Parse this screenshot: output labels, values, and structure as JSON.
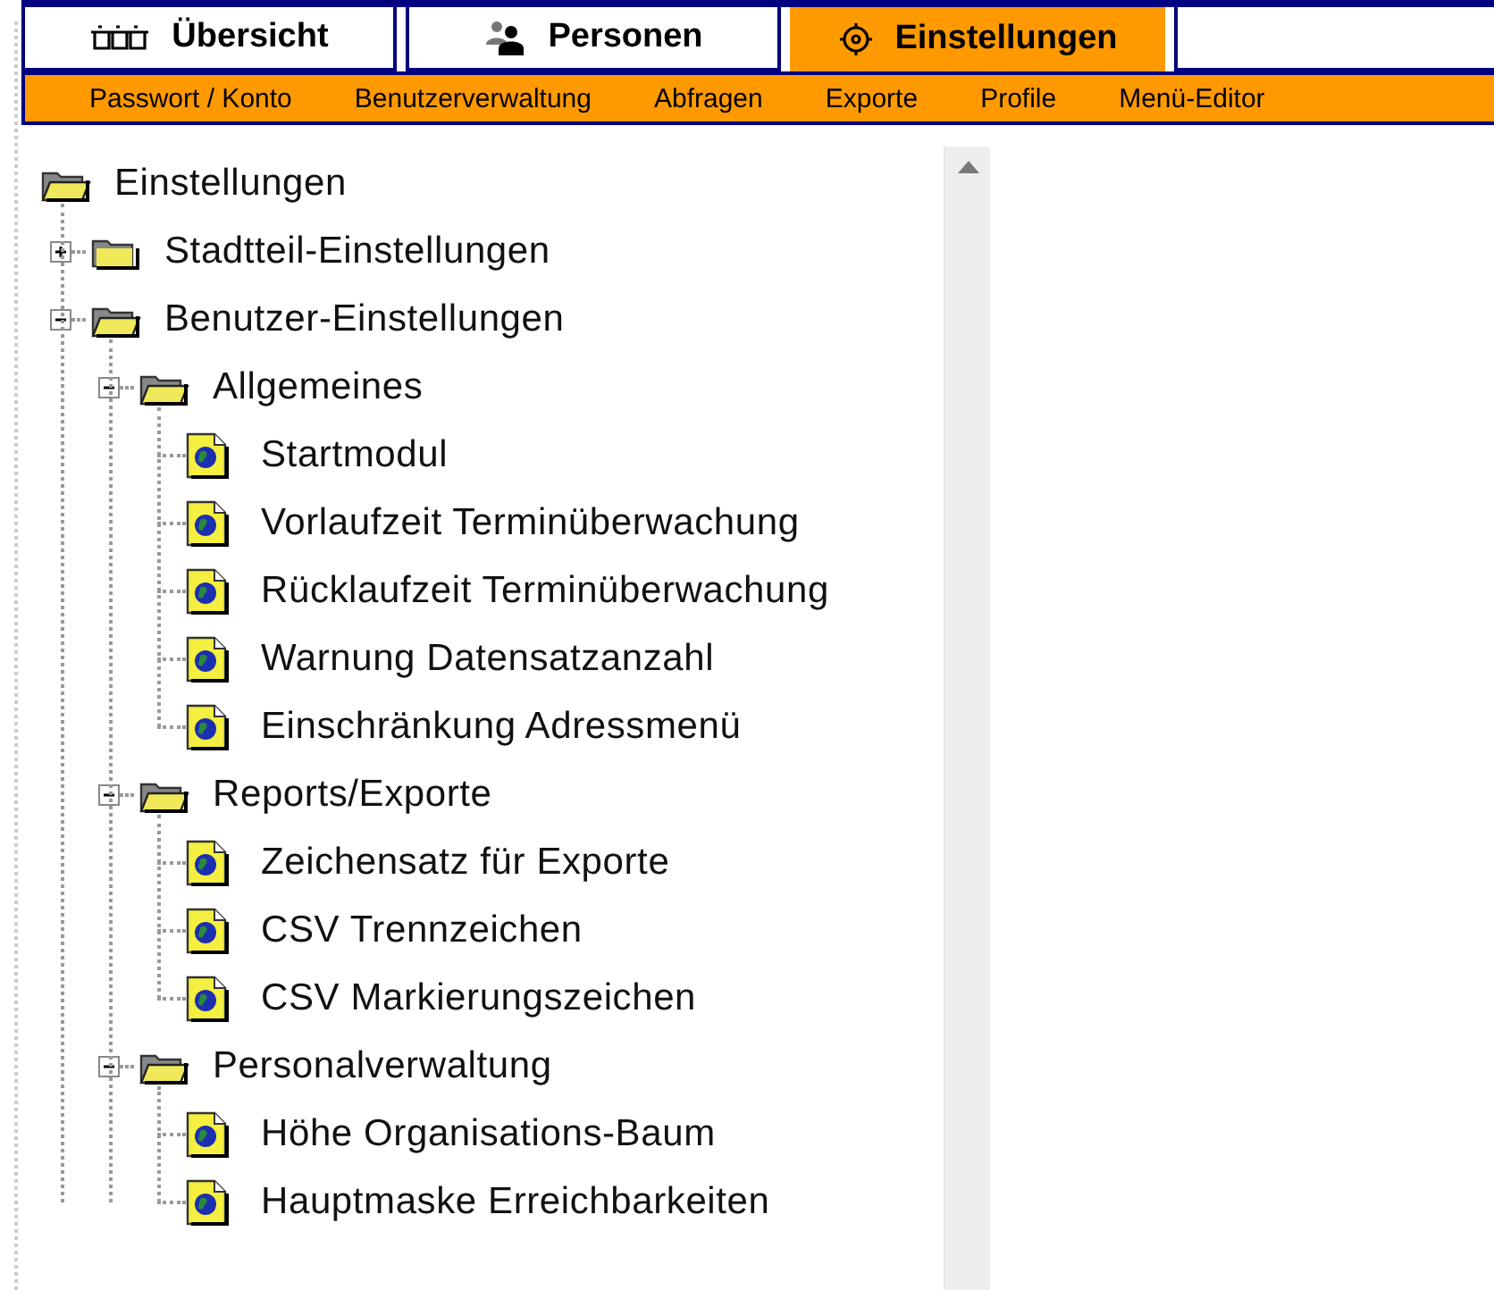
{
  "tabs": [
    {
      "label": "Übersicht",
      "selected": false
    },
    {
      "label": "Personen",
      "selected": false
    },
    {
      "label": "Einstellungen",
      "selected": true
    }
  ],
  "subnav": [
    "Passwort / Konto",
    "Benutzerverwaltung",
    "Abfragen",
    "Exporte",
    "Profile",
    "Menü-Editor"
  ],
  "tree": {
    "label": "Einstellungen",
    "kind": "folder",
    "children": [
      {
        "label": "Stadtteil-Einstellungen",
        "kind": "folder",
        "expanded": false
      },
      {
        "label": "Benutzer-Einstellungen",
        "kind": "folder",
        "expanded": true,
        "children": [
          {
            "label": "Allgemeines",
            "kind": "folder",
            "expanded": true,
            "children": [
              {
                "label": "Startmodul",
                "kind": "leaf"
              },
              {
                "label": "Vorlaufzeit Terminüberwachung",
                "kind": "leaf"
              },
              {
                "label": "Rücklaufzeit Terminüberwachung",
                "kind": "leaf"
              },
              {
                "label": "Warnung Datensatzanzahl",
                "kind": "leaf"
              },
              {
                "label": "Einschränkung Adressmenü",
                "kind": "leaf"
              }
            ]
          },
          {
            "label": "Reports/Exporte",
            "kind": "folder",
            "expanded": true,
            "children": [
              {
                "label": "Zeichensatz für Exporte",
                "kind": "leaf"
              },
              {
                "label": "CSV Trennzeichen",
                "kind": "leaf"
              },
              {
                "label": "CSV Markierungszeichen",
                "kind": "leaf"
              }
            ]
          },
          {
            "label": "Personalverwaltung",
            "kind": "folder",
            "expanded": true,
            "children": [
              {
                "label": "Höhe Organisations-Baum",
                "kind": "leaf"
              },
              {
                "label": "Hauptmaske Erreichbarkeiten",
                "kind": "leaf"
              }
            ]
          }
        ]
      }
    ]
  }
}
